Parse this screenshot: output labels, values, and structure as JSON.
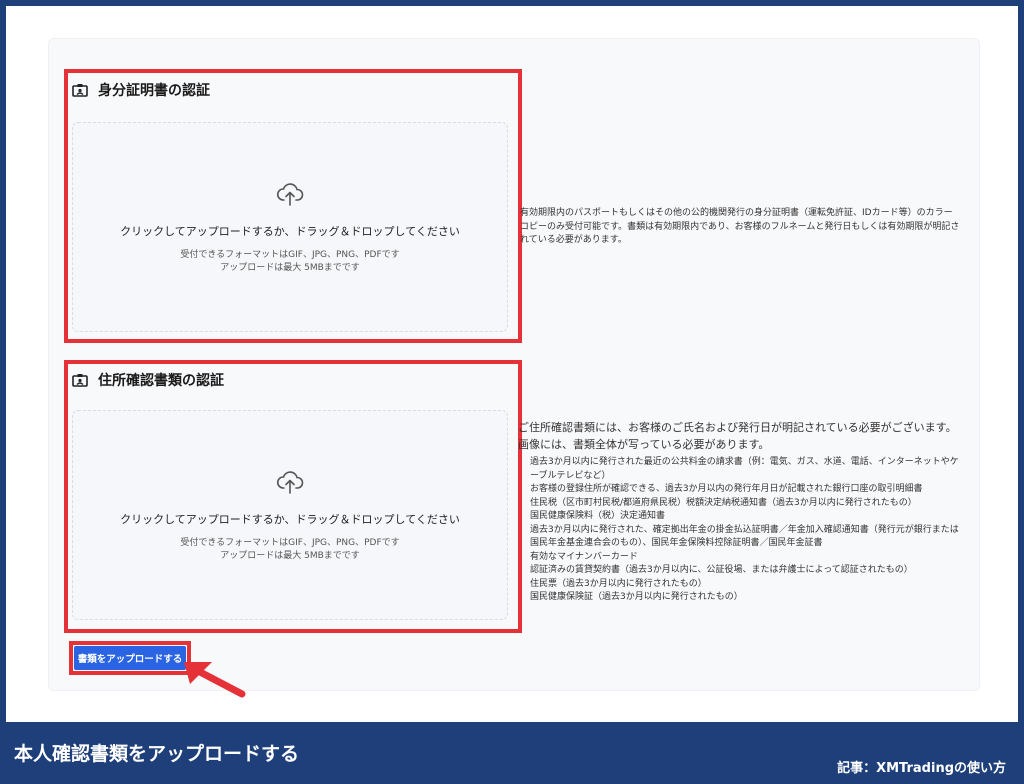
{
  "sections": {
    "identity": {
      "title": "身分証明書の認証",
      "dropzone": {
        "main": "クリックしてアップロードするか、ドラッグ＆ドロップしてください",
        "formats": "受付できるフォーマットはGIF、JPG、PNG、PDFです",
        "maxsize": "アップロードは最大 5MBまでです"
      },
      "description": "有効期限内のパスポートもしくはその他の公的機関発行の身分証明書（運転免許証、IDカード等）のカラーコピーのみ受付可能です。書類は有効期限内であり、お客様のフルネームと発行日もしくは有効期限が明記されている必要があります。"
    },
    "address": {
      "title": "住所確認書類の認証",
      "dropzone": {
        "main": "クリックしてアップロードするか、ドラッグ＆ドロップしてください",
        "formats": "受付できるフォーマットはGIF、JPG、PNG、PDFです",
        "maxsize": "アップロードは最大 5MBまでです"
      },
      "description_head": "ご住所確認書類には、お客様のご氏名および発行日が明記されている必要がございます。画像には、書類全体が写っている必要があります。",
      "items": [
        "過去3か月以内に発行された最近の公共料金の請求書（例：電気、ガス、水道、電話、インターネットやケーブルテレビなど）",
        "お客様の登録住所が確認できる、過去3か月以内の発行年月日が記載された銀行口座の取引明細書",
        "住民税（区市町村民税/都道府県民税）税額決定納税通知書（過去3か月以内に発行されたもの）",
        "国民健康保険料（税）決定通知書",
        "過去3か月以内に発行された、確定拠出年金の掛金払込証明書／年金加入確認通知書（発行元が銀行または国民年金基金連合会のもの）、国民年金保険料控除証明書／国民年金証書",
        "有効なマイナンバーカード",
        "認証済みの賃貸契約書（過去3か月以内に、公証役場、または弁護士によって認証されたもの）",
        "住民票（過去3か月以内に発行されたもの）",
        "国民健康保険証（過去3か月以内に発行されたもの）"
      ]
    }
  },
  "upload_button": "書類をアップロードする",
  "caption": {
    "title": "本人確認書類をアップロードする",
    "source": "記事：XMTradingの使い方"
  },
  "colors": {
    "highlight": "#e53238",
    "button": "#2b64e3",
    "frame": "#1e3f7a"
  }
}
